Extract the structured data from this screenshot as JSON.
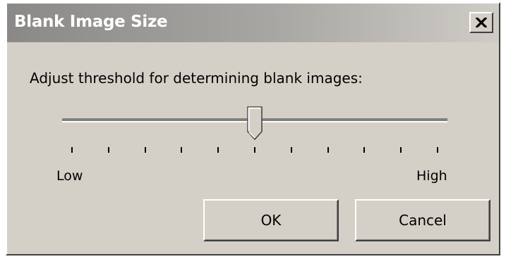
{
  "dialog": {
    "title": "Blank Image Size",
    "close_icon": "close-icon",
    "prompt": "Adjust threshold for determining blank images:"
  },
  "slider": {
    "low_label": "Low",
    "high_label": "High",
    "tick_count": 11,
    "value_fraction": 0.5
  },
  "buttons": {
    "ok_label": "OK",
    "cancel_label": "Cancel"
  },
  "colors": {
    "face": "#d4d0c8",
    "titlebar_inactive_start": "#8b8987",
    "titlebar_inactive_end": "#cfccc6",
    "title_text": "#ffffff"
  }
}
